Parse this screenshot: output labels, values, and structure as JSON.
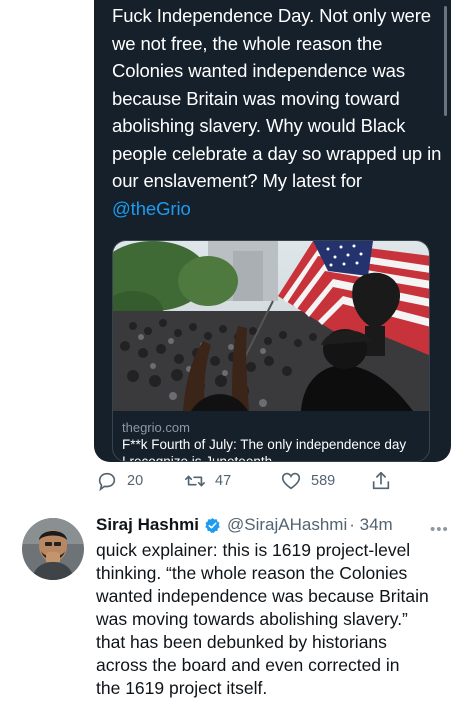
{
  "quoted": {
    "text": "Fuck Independence Day. Not only were we not free, the whole reason the Colonies wanted independence was because Britain was moving toward abolishing slavery. Why would Black people celebrate a day so wrapped up in our enslavement? My latest for",
    "mention": "@theGrio",
    "link": {
      "domain": "thegrio.com",
      "title_line1": "F**k Fourth of July: The only independence day",
      "title_line2": "I recognize is Juneteenth"
    }
  },
  "actions": {
    "replies": "20",
    "retweets": "47",
    "likes": "589"
  },
  "reply": {
    "name": "Siraj Hashmi",
    "handle": "@SirajAHashmi",
    "time": "· 34m",
    "text": "quick explainer: this is 1619 project-level\nthinking. “the whole reason the Colonies\nwanted independence was because Britain\nwas moving towards abolishing slavery.”\nthat has been debunked by historians\nacross the board and even corrected in\nthe 1619 project itself."
  },
  "colors": {
    "dark_bg": "#15202b",
    "link_blue": "#1d9bf0",
    "verified_blue": "#1d9bf0",
    "muted": "#536471"
  },
  "icons": {
    "reply": "reply-icon",
    "retweet": "retweet-icon",
    "like": "heart-icon",
    "share": "share-icon",
    "verified": "verified-badge-icon",
    "more": "more-icon"
  }
}
